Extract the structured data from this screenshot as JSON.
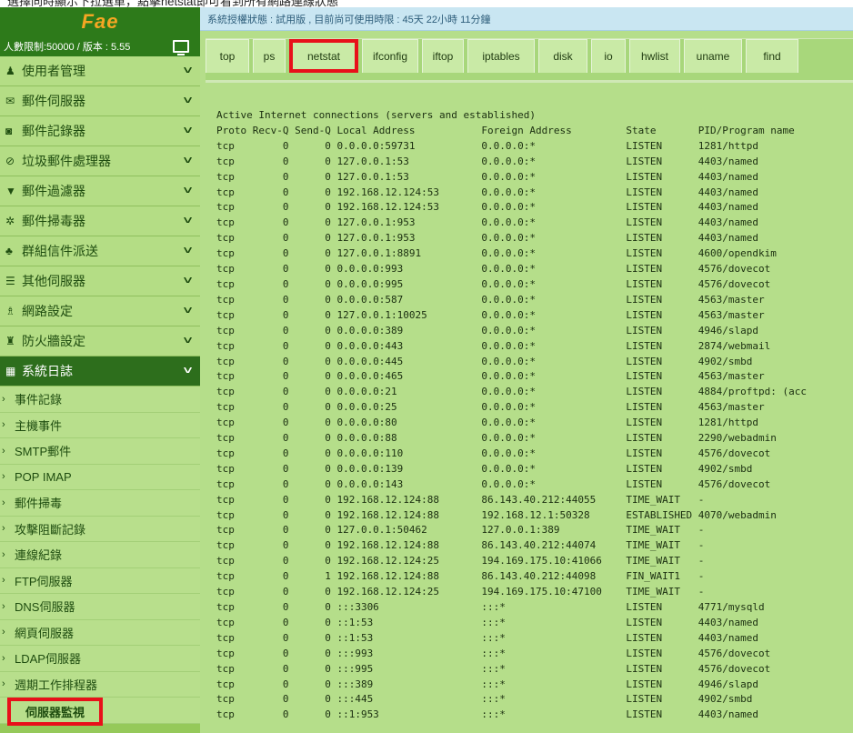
{
  "top_strip_text": "選擇同時顯示下拉選單，點擊netstat即可看到所有網路連線狀態",
  "sidebar": {
    "logo": "Fae",
    "limits": "人數限制:50000 / 版本 : 5.55",
    "menu": [
      {
        "label": "使用者管理",
        "icon": "user-icon",
        "glyph": "♟"
      },
      {
        "label": "郵件伺服器",
        "icon": "envelope-icon",
        "glyph": "✉"
      },
      {
        "label": "郵件記錄器",
        "icon": "camera-icon",
        "glyph": "◙"
      },
      {
        "label": "垃圾郵件處理器",
        "icon": "ban-icon",
        "glyph": "⊘"
      },
      {
        "label": "郵件過濾器",
        "icon": "filter-icon",
        "glyph": "▼"
      },
      {
        "label": "郵件掃毒器",
        "icon": "bug-icon",
        "glyph": "✲"
      },
      {
        "label": "群組信件派送",
        "icon": "users-icon",
        "glyph": "♣"
      },
      {
        "label": "其他伺服器",
        "icon": "server-icon",
        "glyph": "☰"
      },
      {
        "label": "網路設定",
        "icon": "sitemap-icon",
        "glyph": "♗"
      },
      {
        "label": "防火牆設定",
        "icon": "fire-icon",
        "glyph": "♜"
      },
      {
        "label": "系統日誌",
        "icon": "calendar-icon",
        "glyph": "▦"
      }
    ],
    "submenu": [
      "事件記錄",
      "主機事件",
      "SMTP郵件",
      "POP IMAP",
      "郵件掃毒",
      "攻擊阻斷記錄",
      "連線紀錄",
      "FTP伺服器",
      "DNS伺服器",
      "網頁伺服器",
      "LDAP伺服器",
      "週期工作排程器",
      "伺服器監視"
    ],
    "chevron": "⌄"
  },
  "status_text": "系統授權狀態 : 試用版 , 目前尚可使用時限 : 45天 22小時 11分鐘",
  "tabs": [
    "top",
    "ps",
    "netstat",
    "ifconfig",
    "iftop",
    "iptables",
    "disk",
    "io",
    "hwlist",
    "uname",
    "find"
  ],
  "selected_tab": "netstat",
  "netstat": {
    "title": "Active Internet connections (servers and established)",
    "header": "Proto Recv-Q Send-Q Local Address           Foreign Address         State       PID/Program name",
    "rows": [
      "tcp        0      0 0.0.0.0:59731           0.0.0.0:*               LISTEN      1281/httpd",
      "tcp        0      0 127.0.0.1:53            0.0.0.0:*               LISTEN      4403/named",
      "tcp        0      0 127.0.0.1:53            0.0.0.0:*               LISTEN      4403/named",
      "tcp        0      0 192.168.12.124:53       0.0.0.0:*               LISTEN      4403/named",
      "tcp        0      0 192.168.12.124:53       0.0.0.0:*               LISTEN      4403/named",
      "tcp        0      0 127.0.0.1:953           0.0.0.0:*               LISTEN      4403/named",
      "tcp        0      0 127.0.0.1:953           0.0.0.0:*               LISTEN      4403/named",
      "tcp        0      0 127.0.0.1:8891          0.0.0.0:*               LISTEN      4600/opendkim",
      "tcp        0      0 0.0.0.0:993             0.0.0.0:*               LISTEN      4576/dovecot",
      "tcp        0      0 0.0.0.0:995             0.0.0.0:*               LISTEN      4576/dovecot",
      "tcp        0      0 0.0.0.0:587             0.0.0.0:*               LISTEN      4563/master",
      "tcp        0      0 127.0.0.1:10025         0.0.0.0:*               LISTEN      4563/master",
      "tcp        0      0 0.0.0.0:389             0.0.0.0:*               LISTEN      4946/slapd",
      "tcp        0      0 0.0.0.0:443             0.0.0.0:*               LISTEN      2874/webmail",
      "tcp        0      0 0.0.0.0:445             0.0.0.0:*               LISTEN      4902/smbd",
      "tcp        0      0 0.0.0.0:465             0.0.0.0:*               LISTEN      4563/master",
      "tcp        0      0 0.0.0.0:21              0.0.0.0:*               LISTEN      4884/proftpd: (acc",
      "tcp        0      0 0.0.0.0:25              0.0.0.0:*               LISTEN      4563/master",
      "tcp        0      0 0.0.0.0:80              0.0.0.0:*               LISTEN      1281/httpd",
      "tcp        0      0 0.0.0.0:88              0.0.0.0:*               LISTEN      2290/webadmin",
      "tcp        0      0 0.0.0.0:110             0.0.0.0:*               LISTEN      4576/dovecot",
      "tcp        0      0 0.0.0.0:139             0.0.0.0:*               LISTEN      4902/smbd",
      "tcp        0      0 0.0.0.0:143             0.0.0.0:*               LISTEN      4576/dovecot",
      "tcp        0      0 192.168.12.124:88       86.143.40.212:44055     TIME_WAIT   -",
      "tcp        0      0 192.168.12.124:88       192.168.12.1:50328      ESTABLISHED 4070/webadmin",
      "tcp        0      0 127.0.0.1:50462         127.0.0.1:389           TIME_WAIT   -",
      "tcp        0      0 192.168.12.124:88       86.143.40.212:44074     TIME_WAIT   -",
      "tcp        0      0 192.168.12.124:25       194.169.175.10:41066    TIME_WAIT   -",
      "tcp        0      1 192.168.12.124:88       86.143.40.212:44098     FIN_WAIT1   -",
      "tcp        0      0 192.168.12.124:25       194.169.175.10:47100    TIME_WAIT   -",
      "tcp        0      0 :::3306                 :::*                    LISTEN      4771/mysqld",
      "tcp        0      0 ::1:53                  :::*                    LISTEN      4403/named",
      "tcp        0      0 ::1:53                  :::*                    LISTEN      4403/named",
      "tcp        0      0 :::993                  :::*                    LISTEN      4576/dovecot",
      "tcp        0      0 :::995                  :::*                    LISTEN      4576/dovecot",
      "tcp        0      0 :::389                  :::*                    LISTEN      4946/slapd",
      "tcp        0      0 :::445                  :::*                    LISTEN      4902/smbd",
      "tcp        0      0 ::1:953                 :::*                    LISTEN      4403/named"
    ]
  }
}
